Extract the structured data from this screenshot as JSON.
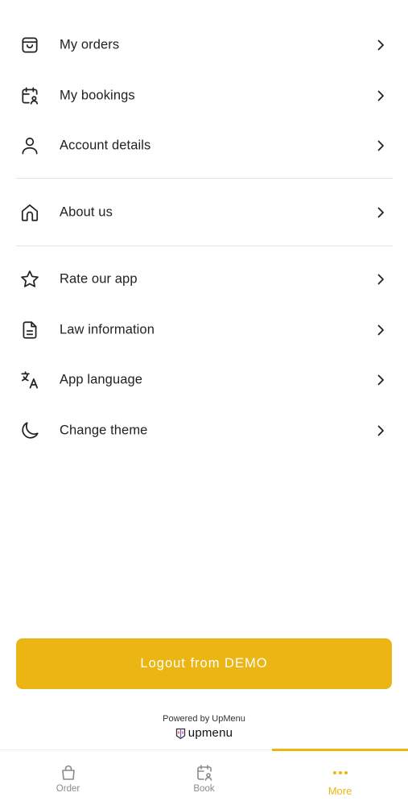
{
  "menu": {
    "items": [
      {
        "label": "My orders",
        "icon": "shopping-bag-icon"
      },
      {
        "label": "My bookings",
        "icon": "calendar-user-icon"
      },
      {
        "label": "Account details",
        "icon": "user-icon"
      },
      {
        "label": "About us",
        "icon": "home-icon"
      },
      {
        "label": "Rate our app",
        "icon": "star-icon"
      },
      {
        "label": "Law information",
        "icon": "document-icon"
      },
      {
        "label": "App language",
        "icon": "translate-icon"
      },
      {
        "label": "Change theme",
        "icon": "moon-icon"
      }
    ]
  },
  "logout": {
    "label": "Logout from DEMO"
  },
  "footer": {
    "powered_by": "Powered by UpMenu",
    "brand": "upmenu"
  },
  "tabbar": {
    "tabs": [
      {
        "label": "Order",
        "icon": "shopping-bag-icon",
        "active": false
      },
      {
        "label": "Book",
        "icon": "calendar-user-icon",
        "active": false
      },
      {
        "label": "More",
        "icon": "more-dots-icon",
        "active": true
      }
    ]
  },
  "colors": {
    "accent": "#ebb513",
    "text": "#222222",
    "muted": "#8a8a8a",
    "divider": "#e3e3e3"
  }
}
